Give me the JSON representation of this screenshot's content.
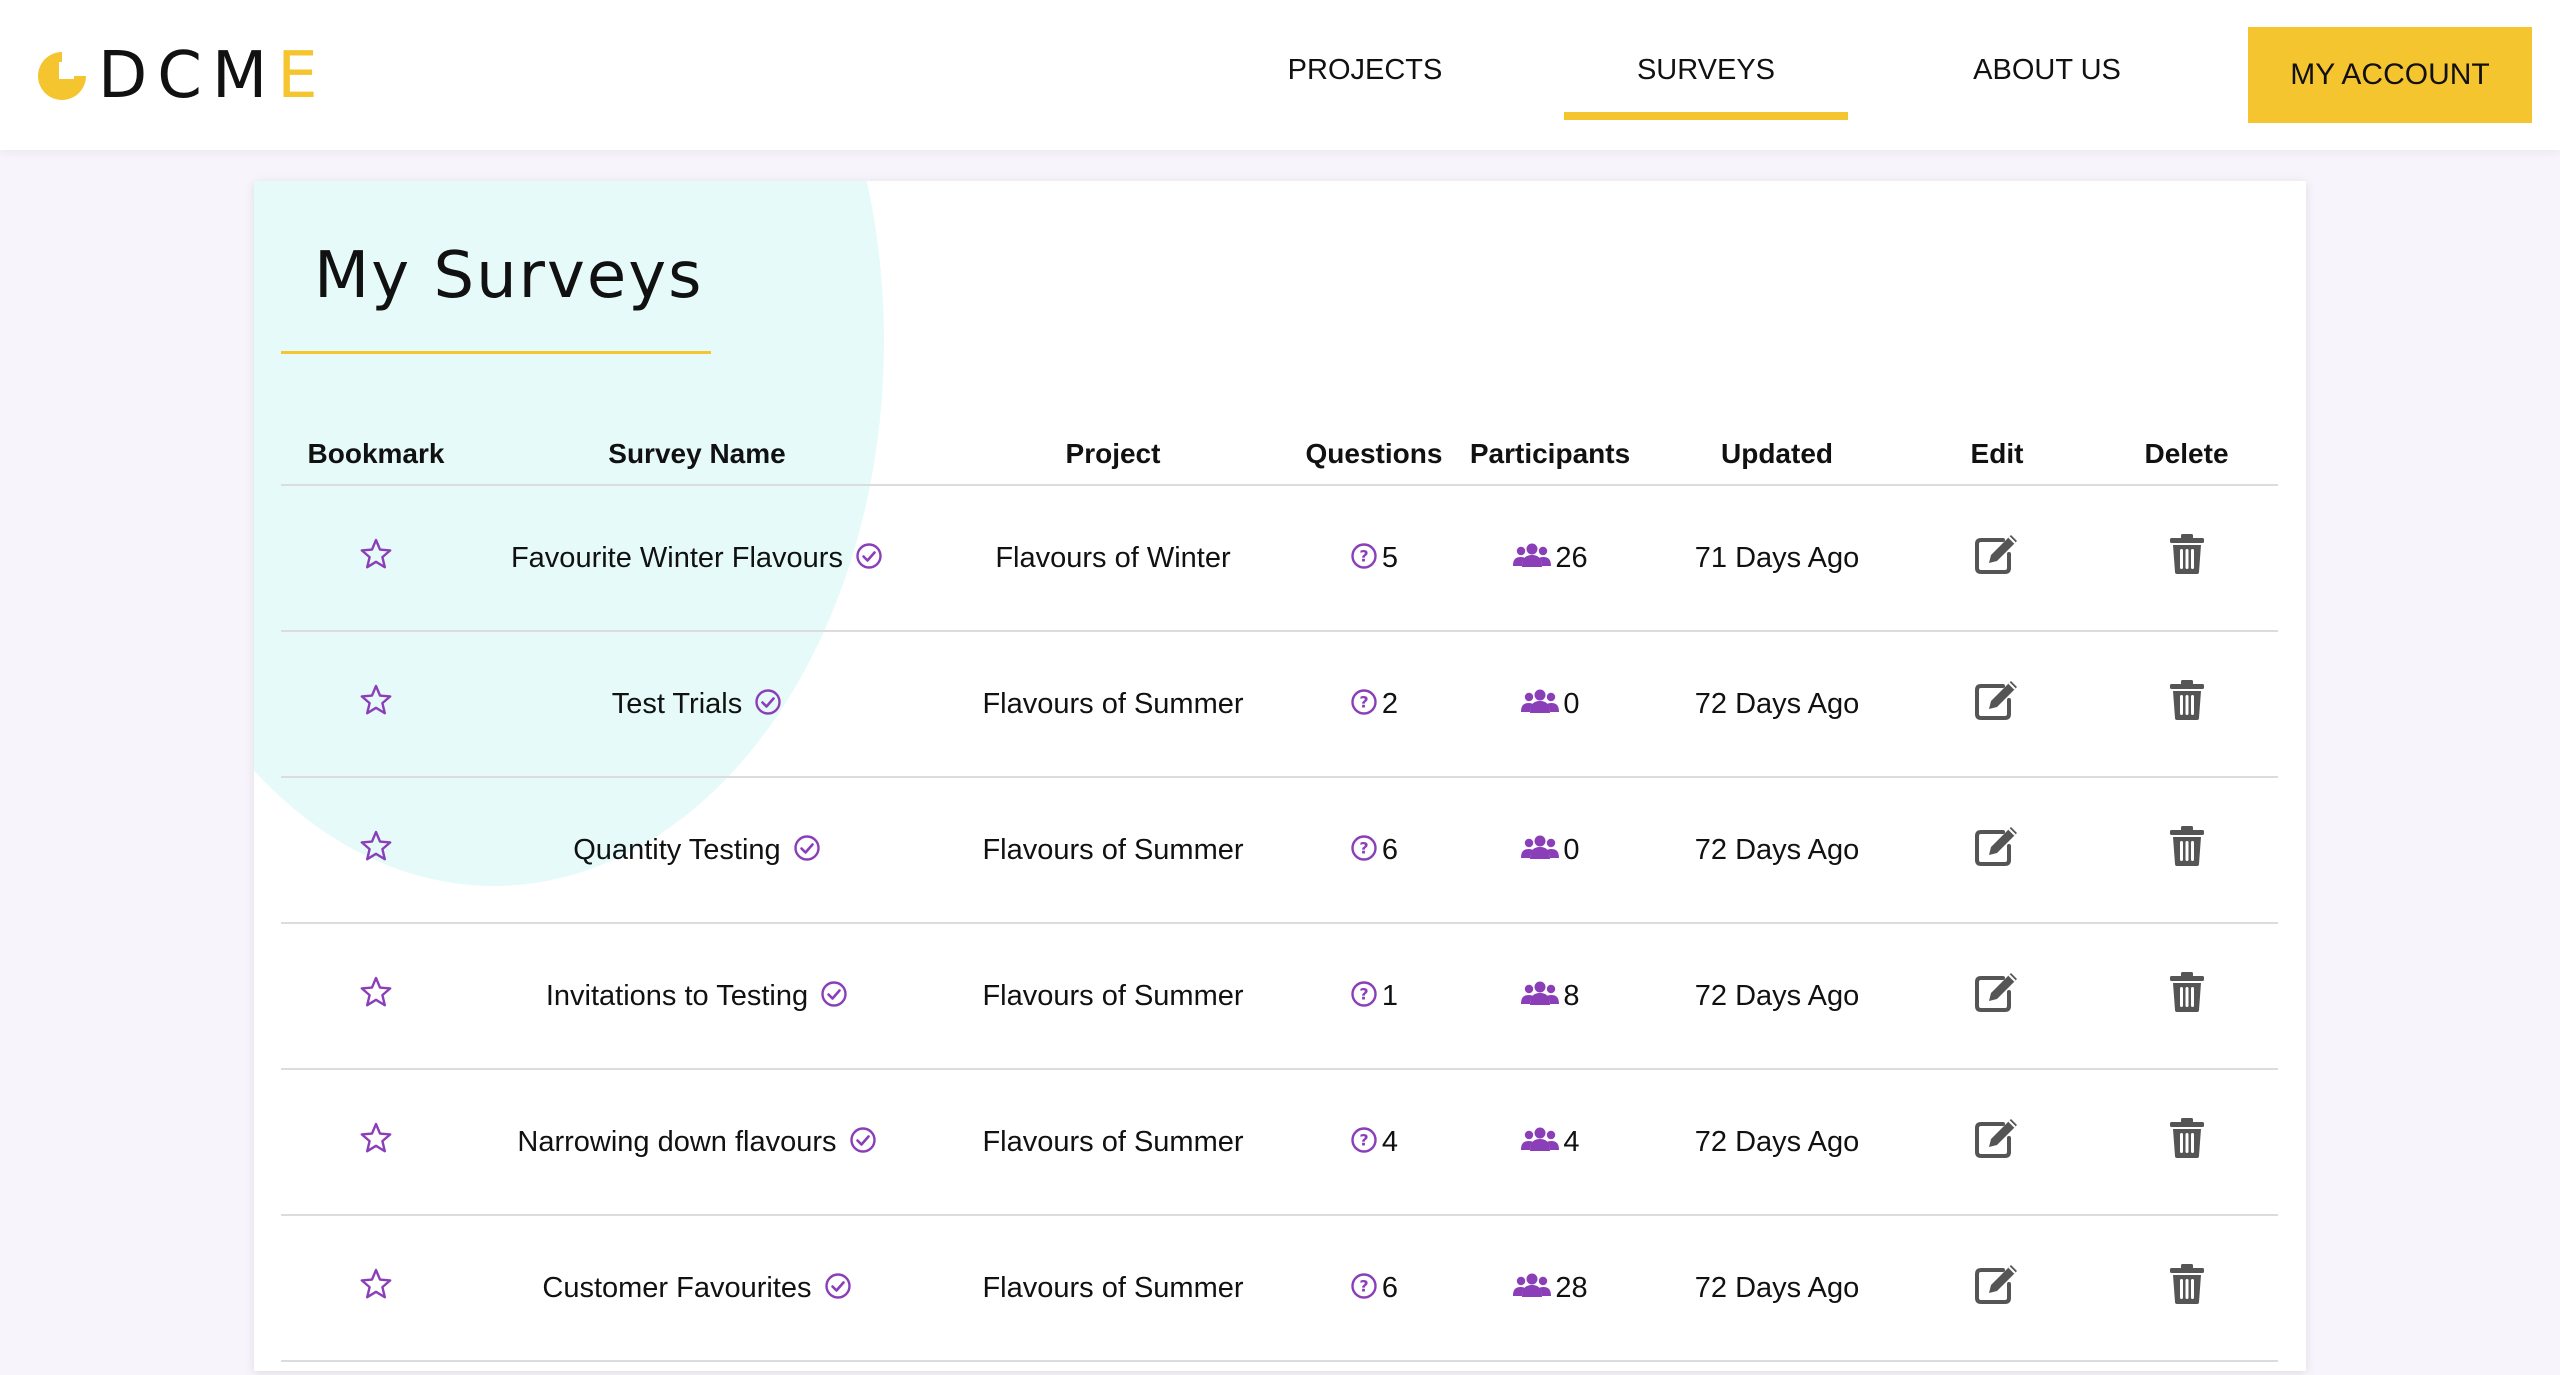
{
  "brand": {
    "logo_prefix": "DCM",
    "logo_accent": "E",
    "accent_color": "#f5c530",
    "icon": "pie-chart-logo"
  },
  "nav": {
    "projects": "PROJECTS",
    "surveys": "SURVEYS",
    "about": "ABOUT US",
    "active": "SURVEYS",
    "account": "MY ACCOUNT"
  },
  "page": {
    "title": "My Surveys"
  },
  "table": {
    "headers": {
      "bookmark": "Bookmark",
      "name": "Survey Name",
      "project": "Project",
      "questions": "Questions",
      "participants": "Participants",
      "updated": "Updated",
      "edit": "Edit",
      "delete": "Delete"
    },
    "rows": [
      {
        "name": "Favourite Winter Flavours",
        "project": "Flavours of Winter",
        "questions": "5",
        "participants": "26",
        "updated": "71 Days Ago"
      },
      {
        "name": "Test Trials",
        "project": "Flavours of Summer",
        "questions": "2",
        "participants": "0",
        "updated": "72 Days Ago"
      },
      {
        "name": "Quantity Testing",
        "project": "Flavours of Summer",
        "questions": "6",
        "participants": "0",
        "updated": "72 Days Ago"
      },
      {
        "name": "Invitations to Testing",
        "project": "Flavours of Summer",
        "questions": "1",
        "participants": "8",
        "updated": "72 Days Ago"
      },
      {
        "name": "Narrowing down flavours",
        "project": "Flavours of Summer",
        "questions": "4",
        "participants": "4",
        "updated": "72 Days Ago"
      },
      {
        "name": "Customer Favourites",
        "project": "Flavours of Summer",
        "questions": "6",
        "participants": "28",
        "updated": "72 Days Ago"
      }
    ]
  },
  "icons": {
    "bookmark": "star-outline-icon",
    "verified": "check-circle-icon",
    "questions": "question-circle-icon",
    "participants": "users-icon",
    "edit": "edit-icon",
    "delete": "trash-icon",
    "icon_purple": "#8a3fb8",
    "icon_gray": "#555555"
  }
}
